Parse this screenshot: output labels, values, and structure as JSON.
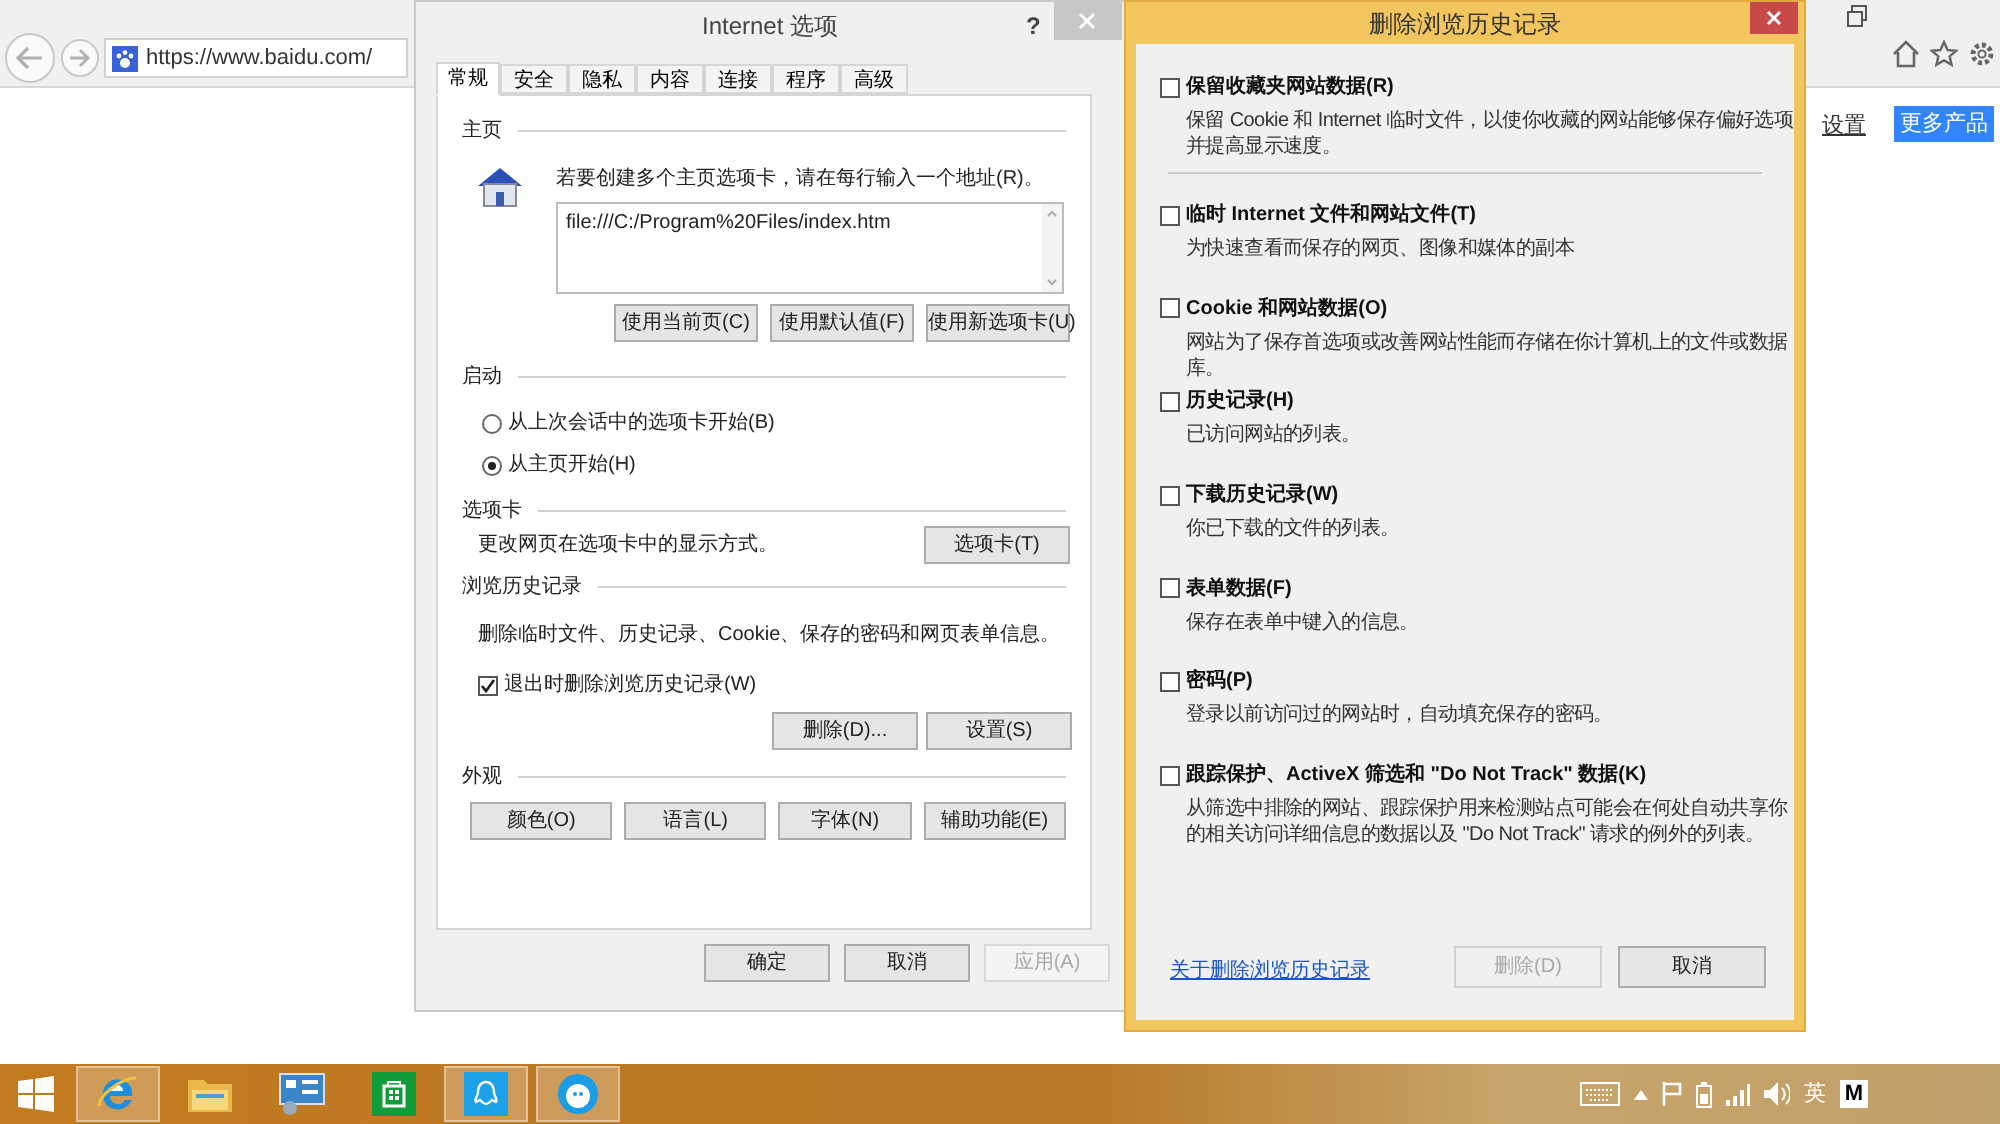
{
  "browser": {
    "address": "https://www.baidu.com/",
    "settings_link": "设置",
    "more_button": "更多产品"
  },
  "internet_options": {
    "title": "Internet 选项",
    "help": "?",
    "tabs": [
      {
        "label": "常规",
        "selected": true
      },
      {
        "label": "安全",
        "selected": false
      },
      {
        "label": "隐私",
        "selected": false
      },
      {
        "label": "内容",
        "selected": false
      },
      {
        "label": "连接",
        "selected": false
      },
      {
        "label": "程序",
        "selected": false
      },
      {
        "label": "高级",
        "selected": false
      }
    ],
    "homepage": {
      "heading": "主页",
      "instruction": "若要创建多个主页选项卡，请在每行输入一个地址(R)。",
      "value": "file:///C:/Program%20Files/index.htm",
      "buttons": [
        "使用当前页(C)",
        "使用默认值(F)",
        "使用新选项卡(U)"
      ]
    },
    "startup": {
      "heading": "启动",
      "options": [
        {
          "label": "从上次会话中的选项卡开始(B)",
          "selected": false
        },
        {
          "label": "从主页开始(H)",
          "selected": true
        }
      ]
    },
    "tabs_section": {
      "heading": "选项卡",
      "description": "更改网页在选项卡中的显示方式。",
      "button": "选项卡(T)"
    },
    "history": {
      "heading": "浏览历史记录",
      "description": "删除临时文件、历史记录、Cookie、保存的密码和网页表单信息。",
      "checkbox": {
        "label": "退出时删除浏览历史记录(W)",
        "checked": true
      },
      "buttons": [
        "删除(D)...",
        "设置(S)"
      ]
    },
    "appearance": {
      "heading": "外观",
      "buttons": [
        "颜色(O)",
        "语言(L)",
        "字体(N)",
        "辅助功能(E)"
      ]
    },
    "footer_buttons": [
      {
        "label": "确定",
        "disabled": false
      },
      {
        "label": "取消",
        "disabled": false
      },
      {
        "label": "应用(A)",
        "disabled": true
      }
    ]
  },
  "delete_dialog": {
    "title": "删除浏览历史记录",
    "options": [
      {
        "label": "保留收藏夹网站数据(R)",
        "description": "保留 Cookie 和 Internet 临时文件，以使你收藏的网站能够保存偏好选项并提高显示速度。",
        "checked": false
      },
      {
        "label": "临时 Internet 文件和网站文件(T)",
        "description": "为快速查看而保存的网页、图像和媒体的副本",
        "checked": false
      },
      {
        "label": "Cookie 和网站数据(O)",
        "description": "网站为了保存首选项或改善网站性能而存储在你计算机上的文件或数据库。",
        "checked": false
      },
      {
        "label": "历史记录(H)",
        "description": "已访问网站的列表。",
        "checked": false
      },
      {
        "label": "下载历史记录(W)",
        "description": "你已下载的文件的列表。",
        "checked": false
      },
      {
        "label": "表单数据(F)",
        "description": "保存在表单中键入的信息。",
        "checked": false
      },
      {
        "label": "密码(P)",
        "description": "登录以前访问过的网站时，自动填充保存的密码。",
        "checked": false
      },
      {
        "label": "跟踪保护、ActiveX 筛选和 \"Do Not Track\" 数据(K)",
        "description": "从筛选中排除的网站、跟踪保护用来检测站点可能会在何处自动共享你的相关访问详细信息的数据以及 \"Do Not Track\" 请求的例外的列表。",
        "checked": false
      }
    ],
    "link": "关于删除浏览历史记录",
    "buttons": [
      {
        "label": "删除(D)",
        "disabled": true
      },
      {
        "label": "取消",
        "disabled": false
      }
    ]
  },
  "taskbar": {
    "apps": [
      {
        "kind": "ie",
        "running": true
      },
      {
        "kind": "folder",
        "running": false
      },
      {
        "kind": "control",
        "running": false
      },
      {
        "kind": "store",
        "running": false
      },
      {
        "kind": "chat",
        "running": true
      },
      {
        "kind": "bird",
        "running": true
      }
    ],
    "language": "英",
    "ime": "M"
  }
}
